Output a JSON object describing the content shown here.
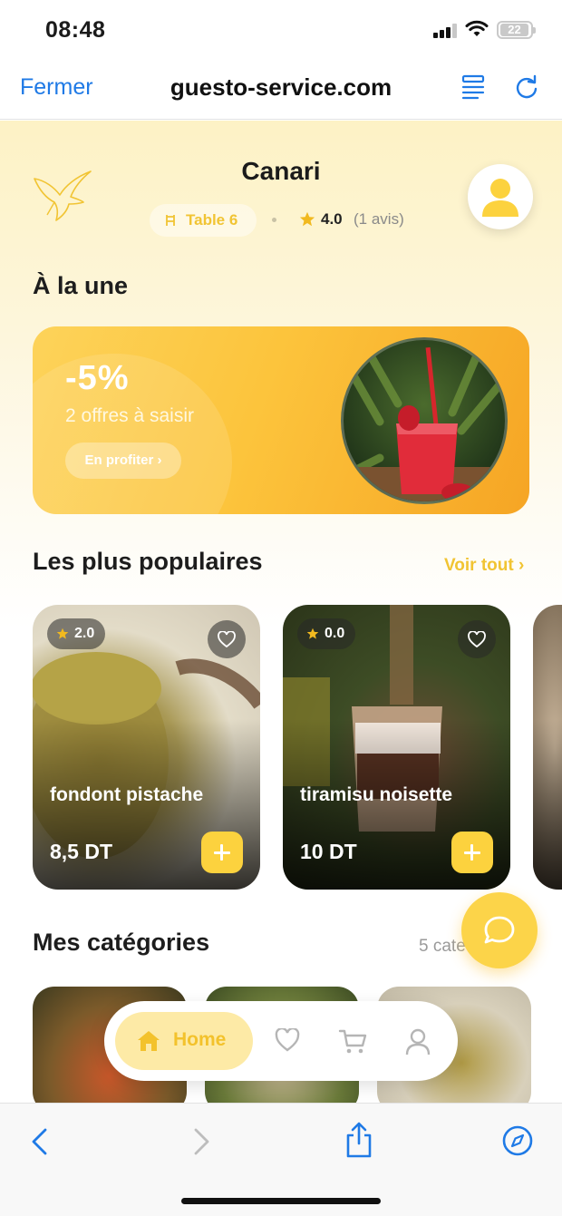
{
  "status_bar": {
    "time": "08:48",
    "battery": "22"
  },
  "browser": {
    "close_label": "Fermer",
    "url": "guesto-service.com"
  },
  "restaurant": {
    "name": "Canari",
    "table": "Table 6",
    "rating": "4.0",
    "reviews": "(1 avis)"
  },
  "featured": {
    "title": "À la une",
    "discount": "-5%",
    "offers": "2 offres à saisir",
    "cta": "En profiter ›"
  },
  "popular": {
    "title": "Les plus populaires",
    "see_all": "Voir tout ›",
    "items": [
      {
        "name": "fondont pistache",
        "rating": "2.0",
        "price": "8,5 DT"
      },
      {
        "name": "tiramisu noisette",
        "rating": "0.0",
        "price": "10 DT"
      }
    ]
  },
  "categories": {
    "title": "Mes catégories",
    "count": "5 cate"
  },
  "bottom_nav": {
    "home_label": "Home"
  },
  "colors": {
    "accent": "#fcd23e",
    "link_blue": "#1f7ae6"
  }
}
